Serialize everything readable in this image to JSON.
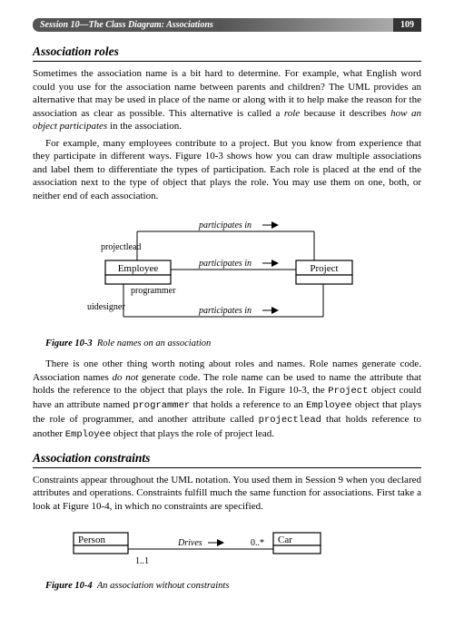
{
  "header": {
    "session": "Session 10—The Class Diagram: Associations",
    "page": "109"
  },
  "section1": {
    "title": "Association roles",
    "p1a": "Sometimes the association name is a bit hard to determine. For example, what English word could you use for the association name between parents and children? The UML provides an alternative that may be used in place of the name or along with it to help make the reason for the association as clear as possible. This alternative is called a ",
    "p1_role": "role",
    "p1b": " because it describes ",
    "p1_how": "how an object participates",
    "p1c": " in the association.",
    "p2": "For example, many employees contribute to a project. But you know from experience that they participate in different ways. Figure 10-3 shows how you can draw multiple associations and label them to differentiate the types of participation. Each role is placed at the end of the association next to the type of object that plays the role. You may use them on one, both, or neither end of each association."
  },
  "fig1": {
    "employee": "Employee",
    "project": "Project",
    "projectlead": "projectlead",
    "programmer": "programmer",
    "uidesigner": "uidesigner",
    "participates": "participates in",
    "caption_num": "Figure 10-3",
    "caption_title": "Role names on an association"
  },
  "section1b": {
    "p3a": "There is one other thing worth noting about roles and names. Role names generate code. Association names ",
    "p3_donot": "do not",
    "p3b": " generate code. The role name can be used to name the attribute that holds the reference to the object that plays the role. In Figure 10-3, the ",
    "p3_project": "Project",
    "p3c": " object could have an attribute named ",
    "p3_programmer": "programmer",
    "p3d": " that holds a reference to an ",
    "p3_employee": "Employee",
    "p3e": " object that plays the role of programmer, and another attribute called ",
    "p3_projectlead": "projectlead",
    "p3f": " that holds reference to another ",
    "p3_employee2": "Employee",
    "p3g": " object that plays the role of project lead."
  },
  "section2": {
    "title": "Association constraints",
    "p1": "Constraints appear throughout the UML notation. You used them in Session 9 when you declared attributes and operations. Constraints fulfill much the same function for associations. First take a look at Figure 10-4, in which no constraints are specified."
  },
  "fig2": {
    "person": "Person",
    "car": "Car",
    "drives": "Drives",
    "mult_left": "1..1",
    "mult_right": "0..*",
    "caption_num": "Figure 10-4",
    "caption_title": "An association without constraints"
  }
}
